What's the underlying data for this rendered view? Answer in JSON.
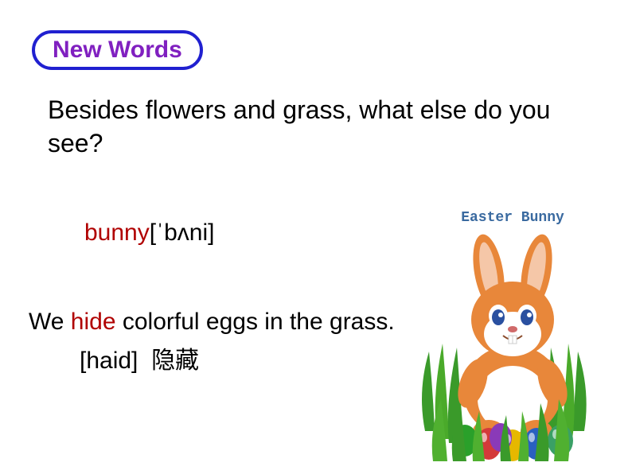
{
  "badge": {
    "label": "New Words"
  },
  "question": "Besides flowers and grass, what else do you see?",
  "vocab": {
    "bunny": {
      "word": "bunny",
      "phonetic": "[ˈbʌni]"
    },
    "hide": {
      "prefix": "We ",
      "word": "hide",
      "suffix": " colorful eggs in the grass.",
      "phonetic": "[haid]",
      "translation": "隐藏"
    }
  },
  "image": {
    "title": "Easter Bunny",
    "eggs": [
      {
        "color": "#2aa02a"
      },
      {
        "color": "#d43a3a"
      },
      {
        "color": "#e6b800"
      },
      {
        "color": "#2a60c0"
      },
      {
        "color": "#3aa066"
      },
      {
        "color": "#8a3ab8"
      }
    ]
  }
}
